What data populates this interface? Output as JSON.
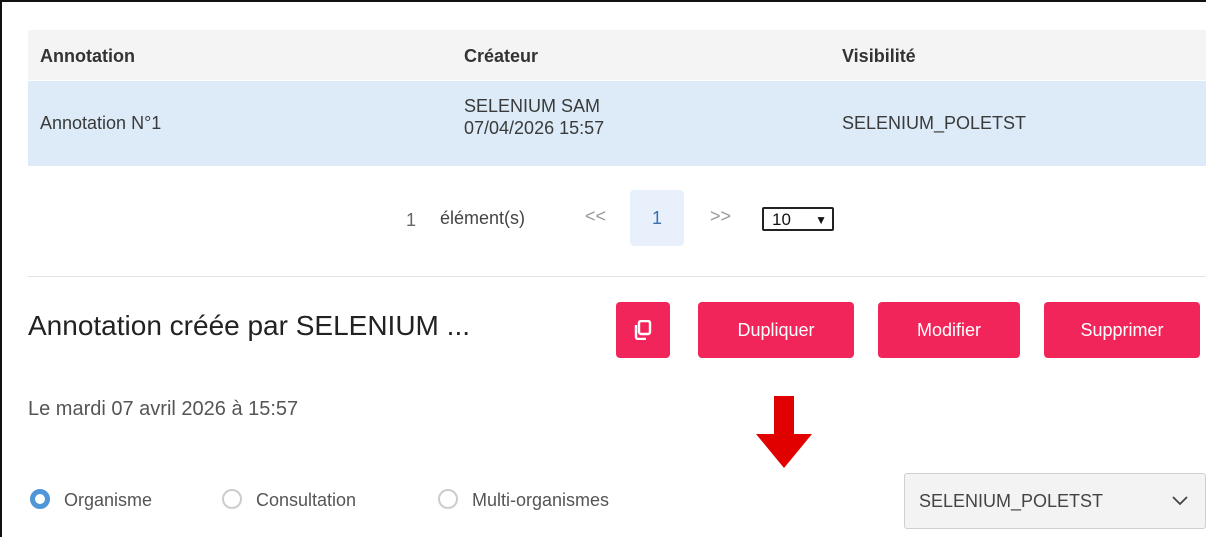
{
  "table": {
    "headers": [
      "Annotation",
      "Créateur",
      "Visibilité"
    ],
    "rows": [
      {
        "annotation": "Annotation N°1",
        "creator_name": "SELENIUM SAM",
        "creator_date": "07/04/2026 15:57",
        "visibility": "SELENIUM_POLETST"
      }
    ]
  },
  "pagination": {
    "count": "1",
    "label": "élément(s)",
    "prev": "<<",
    "current_page": "1",
    "next": ">>",
    "page_size": "10"
  },
  "detail": {
    "title": "Annotation créée par SELENIUM ...",
    "buttons": {
      "duplicate": "Dupliquer",
      "edit": "Modifier",
      "delete": "Supprimer"
    },
    "copy_icon": "copy-icon",
    "date": "Le mardi 07 avril 2026 à 15:57",
    "radios": [
      {
        "label": "Organisme",
        "selected": true
      },
      {
        "label": "Consultation",
        "selected": false
      },
      {
        "label": "Multi-organismes",
        "selected": false
      }
    ],
    "organism_select": "SELENIUM_POLETST"
  },
  "colors": {
    "accent": "#f2255a",
    "selected_row": "#dcebf7",
    "radio": "#4e96d8",
    "arrow": "#e00000"
  }
}
